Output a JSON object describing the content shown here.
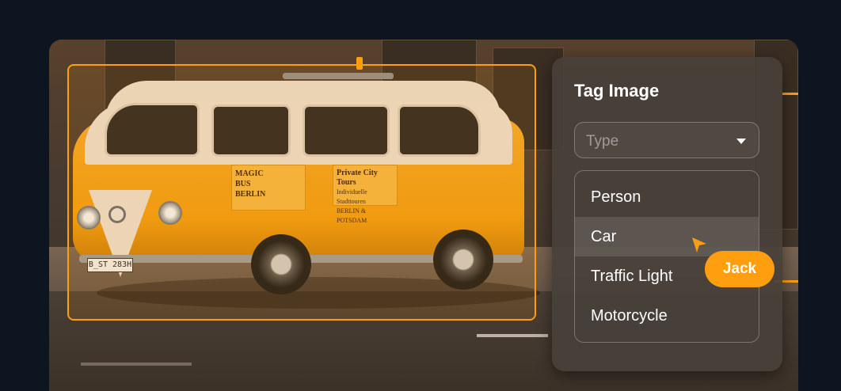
{
  "image": {
    "van_plate": "B_ST 283H",
    "van_sign_left": [
      "MAGIC",
      "BUS",
      "BERLIN"
    ],
    "van_sign_right": [
      "Private City Tours",
      "Individuelle Stadttouren",
      "BERLIN & POTSDAM"
    ]
  },
  "annotation": {
    "box_color": "#ff9f0f"
  },
  "tag_panel": {
    "title": "Tag Image",
    "type_placeholder": "Type",
    "options": [
      {
        "label": "Person"
      },
      {
        "label": "Car",
        "hovered": true
      },
      {
        "label": "Traffic Light"
      },
      {
        "label": "Motorcycle"
      }
    ]
  },
  "collaborator": {
    "name": "Jack",
    "color": "#ff9f0f"
  }
}
